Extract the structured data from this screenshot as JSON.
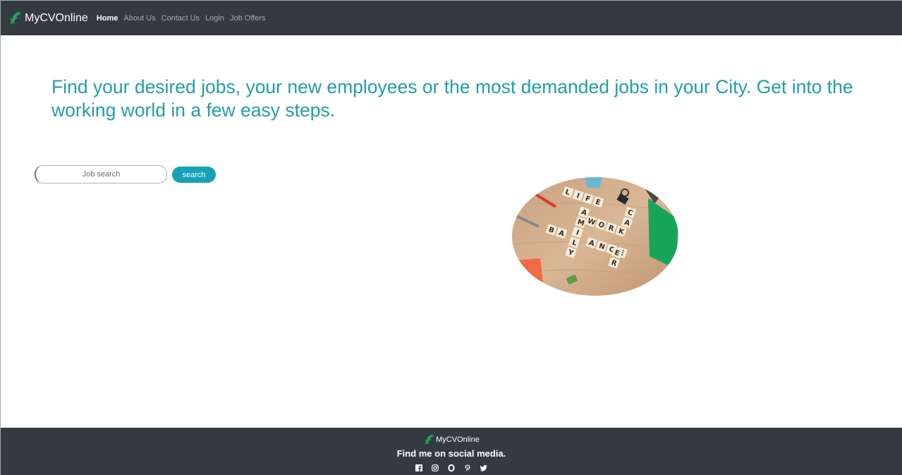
{
  "navbar": {
    "brand": "MyCVOnline",
    "links": [
      {
        "label": "Home",
        "active": true
      },
      {
        "label": "About Us",
        "active": false
      },
      {
        "label": "Contact Us",
        "active": false
      },
      {
        "label": "Login",
        "active": false
      },
      {
        "label": "Job Offers",
        "active": false
      }
    ]
  },
  "hero": {
    "title": "Find your desired jobs, your new employees or the most demanded jobs in your City. Get into the working world in a few easy steps."
  },
  "search": {
    "placeholder": "Job search",
    "value": "",
    "button_label": "search"
  },
  "image": {
    "tiles": {
      "life": "LIFE",
      "family": "FAMILY",
      "balance": "BALANCE",
      "work": "WORK",
      "career": "CAREER"
    }
  },
  "footer": {
    "brand": "MyCVOnline",
    "tagline": "Find me on social media.",
    "social_icons": [
      "facebook-icon",
      "instagram-icon",
      "opera-icon",
      "pinterest-icon",
      "twitter-icon"
    ]
  },
  "colors": {
    "navbar_bg": "#343a40",
    "accent": "#229ea8",
    "button": "#17a2b8",
    "logo_green": "#1fa55a"
  }
}
